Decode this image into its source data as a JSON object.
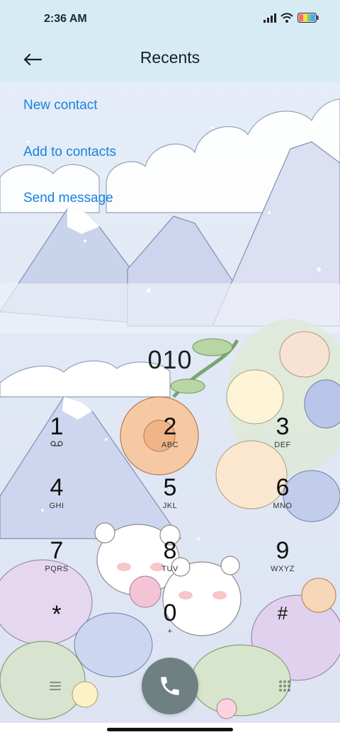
{
  "status": {
    "time": "2:36 AM",
    "battery_colors": [
      "#ff6b6b",
      "#ffd93d",
      "#6bd16b",
      "#4da3ff"
    ]
  },
  "header": {
    "title": "Recents"
  },
  "actions": [
    {
      "label": "New contact"
    },
    {
      "label": "Add to contacts"
    },
    {
      "label": "Send message"
    }
  ],
  "dialer": {
    "number": "010",
    "keys": [
      {
        "digit": "1",
        "letters": ""
      },
      {
        "digit": "2",
        "letters": "ABC"
      },
      {
        "digit": "3",
        "letters": "DEF"
      },
      {
        "digit": "4",
        "letters": "GHI"
      },
      {
        "digit": "5",
        "letters": "JKL"
      },
      {
        "digit": "6",
        "letters": "MNO"
      },
      {
        "digit": "7",
        "letters": "PQRS"
      },
      {
        "digit": "8",
        "letters": "TUV"
      },
      {
        "digit": "9",
        "letters": "WXYZ"
      },
      {
        "digit": "*",
        "letters": ""
      },
      {
        "digit": "0",
        "letters": "+"
      },
      {
        "digit": "#",
        "letters": ""
      }
    ]
  },
  "colors": {
    "accent": "#1683e0",
    "call_button": "#6f8082"
  },
  "icons": [
    "back-arrow-icon",
    "signal-icon",
    "wifi-icon",
    "battery-icon",
    "voicemail-icon",
    "menu-icon",
    "phone-icon",
    "dialpad-icon"
  ]
}
